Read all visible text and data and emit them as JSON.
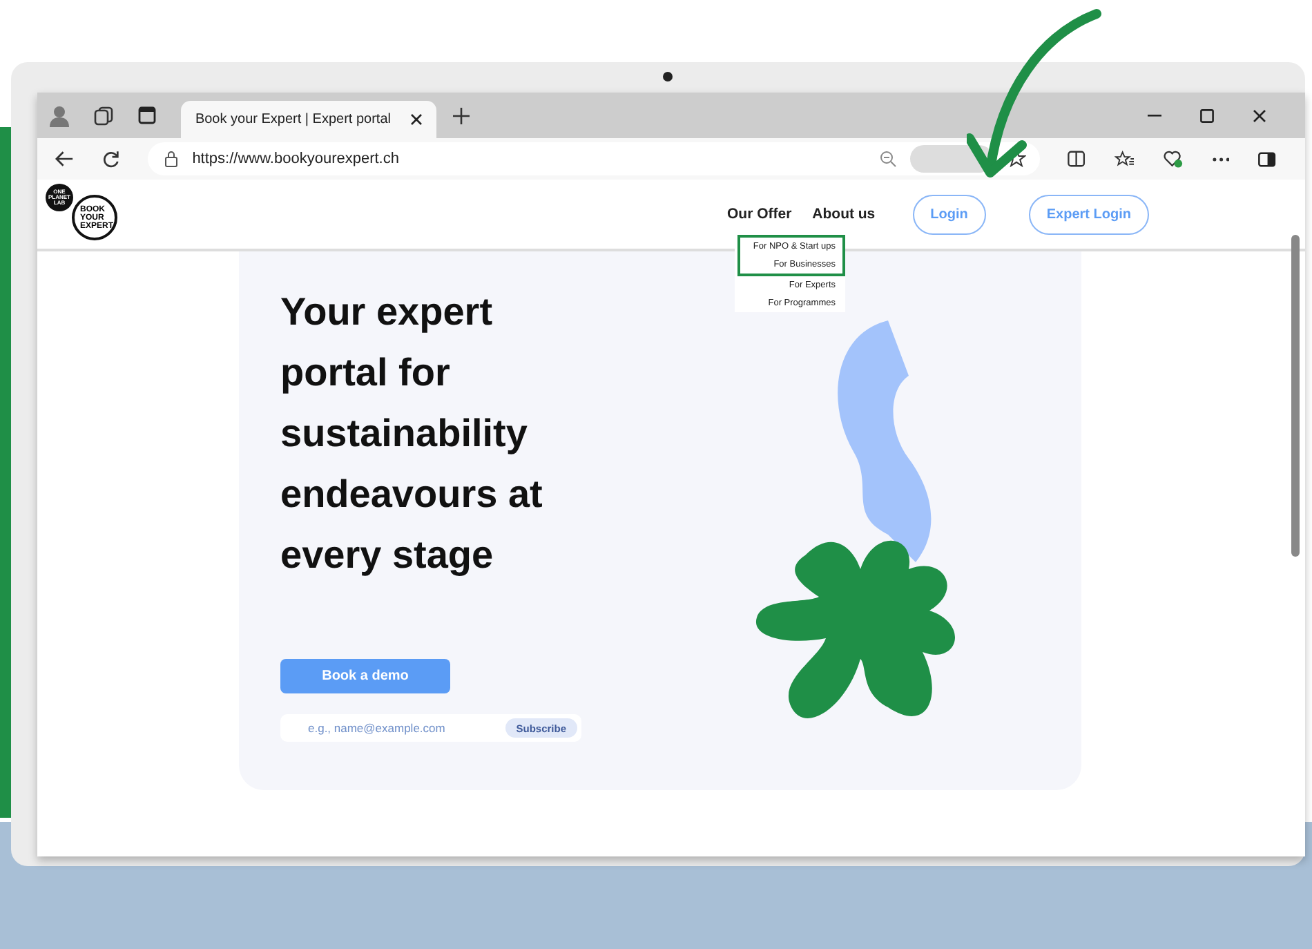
{
  "browser": {
    "tab": {
      "title": "Book your Expert | Expert portal"
    },
    "address": "https://www.bookyourexpert.ch"
  },
  "site": {
    "logo": {
      "badge": [
        "ONE",
        "PLANET",
        "LAB"
      ],
      "wordmark": [
        "BOOK",
        "YOUR",
        "EXPERT"
      ]
    },
    "nav": [
      "Our Offer",
      "About us"
    ],
    "dropdown": [
      {
        "label": "For NPO & Start ups",
        "highlighted": true
      },
      {
        "label": "For Businesses",
        "highlighted": true
      },
      {
        "label": "For Experts",
        "highlighted": false
      },
      {
        "label": "For Programmes",
        "highlighted": false
      }
    ],
    "buttons": [
      {
        "label": "Login"
      },
      {
        "label": "Expert Login"
      }
    ]
  },
  "hero": {
    "heading": "Your expert portal for sustainability endeavours at every stage",
    "cta": "Book a demo",
    "email": {
      "placeholder": "e.g., name@example.com"
    },
    "subscribe": "Subscribe"
  }
}
